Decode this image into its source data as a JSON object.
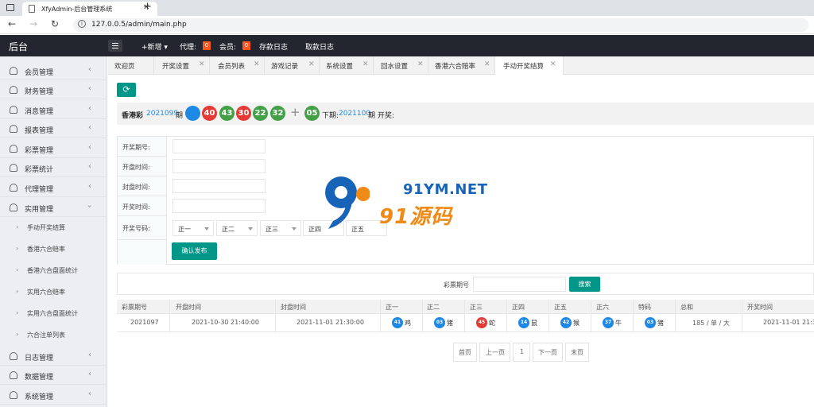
{
  "browser": {
    "tab_title": "XfyAdmin-后台管理系统",
    "url": "127.0.0.5/admin/main.php"
  },
  "header": {
    "brand": "后台",
    "new_label": "+新增 ▾",
    "agent_label": "代理:",
    "agent_count": "0",
    "member_label": "会员:",
    "member_count": "0",
    "deposit_log": "存款日志",
    "withdraw_log": "取款日志"
  },
  "sidebar": {
    "items": [
      {
        "label": "会员管理",
        "icon": "user-icon"
      },
      {
        "label": "财务管理",
        "icon": "book-icon"
      },
      {
        "label": "消息管理",
        "icon": "message-icon"
      },
      {
        "label": "报表管理",
        "icon": "chart-icon"
      },
      {
        "label": "彩票管理",
        "icon": "user-icon"
      },
      {
        "label": "彩票统计",
        "icon": "user-icon"
      },
      {
        "label": "代理管理",
        "icon": "user-icon"
      },
      {
        "label": "实用管理",
        "icon": "user-icon"
      },
      {
        "label": "日志管理",
        "icon": "user-icon"
      },
      {
        "label": "数据管理",
        "icon": "user-icon"
      },
      {
        "label": "系统管理",
        "icon": "user-icon"
      }
    ],
    "sub_items": [
      "手动开奖结算",
      "香港六合赔率",
      "香港六合盘面统计",
      "实用六合赔率",
      "实用六合盘面统计",
      "六合注单列表"
    ]
  },
  "tabs": [
    "欢迎页",
    "开奖设置",
    "会员列表",
    "游戏记录",
    "系统设置",
    "回水设置",
    "香港六合赔率",
    "手动开奖结算"
  ],
  "draw": {
    "game": "香港彩",
    "period": "2021099",
    "period_suffix": "期",
    "balls": [
      {
        "n": "03",
        "color": "blue"
      },
      {
        "n": "40",
        "color": "red"
      },
      {
        "n": "43",
        "color": "green"
      },
      {
        "n": "30",
        "color": "red"
      },
      {
        "n": "22",
        "color": "green"
      },
      {
        "n": "32",
        "color": "green"
      }
    ],
    "special": {
      "n": "05",
      "color": "green"
    },
    "next_label": "下期:",
    "next_period": "2021100",
    "next_suffix": "期 开奖:"
  },
  "form": {
    "period_label": "开奖期号:",
    "open_time_label": "开盘时间:",
    "close_time_label": "封盘时间:",
    "draw_time_label": "开奖时间:",
    "numbers_label": "开奖号码:",
    "selects": [
      "正一",
      "正二",
      "正三",
      "正四",
      "正五"
    ],
    "submit": "确认发布"
  },
  "search": {
    "label": "彩票期号",
    "button": "搜索"
  },
  "table": {
    "headers": [
      "彩票期号",
      "开盘时间",
      "封盘时间",
      "正一",
      "正二",
      "正三",
      "正四",
      "正五",
      "正六",
      "特码",
      "总和",
      "开奖时间"
    ],
    "row": {
      "period": "2021097",
      "open_time": "2021-10-30 21:40:00",
      "close_time": "2021-11-01 21:30:00",
      "balls": [
        {
          "n": "41",
          "z": "鸡",
          "color": "blue"
        },
        {
          "n": "03",
          "z": "猪",
          "color": "blue"
        },
        {
          "n": "45",
          "z": "蛇",
          "color": "red"
        },
        {
          "n": "14",
          "z": "鼠",
          "color": "blue"
        },
        {
          "n": "42",
          "z": "猴",
          "color": "blue"
        },
        {
          "n": "37",
          "z": "牛",
          "color": "blue"
        },
        {
          "n": "03",
          "z": "猪",
          "color": "blue"
        }
      ],
      "total": "185 / 单 / 大",
      "draw_time": "2021-11-01 21:3"
    }
  },
  "pager": [
    "首页",
    "上一页",
    "1",
    "下一页",
    "末页"
  ],
  "watermark": {
    "domain": "91YM.NET",
    "cn": "91源码"
  }
}
